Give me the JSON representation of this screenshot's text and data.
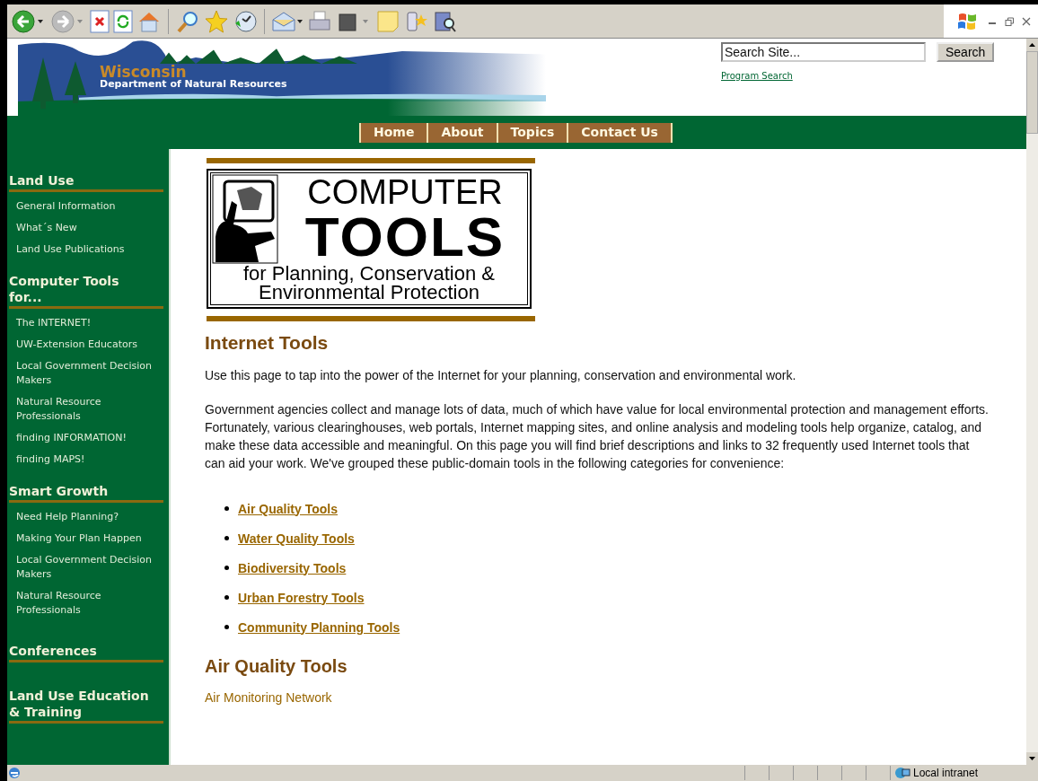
{
  "header": {
    "logo_title": "Wisconsin",
    "logo_subtitle": "Department of Natural Resources",
    "search": {
      "placeholder": "Search Site..."
    },
    "search_button": "Search",
    "program_search_link": "Program Search"
  },
  "nav": [
    {
      "label": "Home"
    },
    {
      "label": "About"
    },
    {
      "label": "Topics"
    },
    {
      "label": "Contact Us"
    }
  ],
  "sidebar": [
    {
      "heading": "Land Use",
      "items": [
        "General Information",
        "What´s New",
        "Land Use Publications"
      ]
    },
    {
      "heading": "Computer Tools for...",
      "items": [
        "The INTERNET!",
        "UW-Extension Educators",
        "Local Government Decision Makers",
        "Natural Resource Professionals",
        "finding INFORMATION!",
        "finding MAPS!"
      ]
    },
    {
      "heading": "Smart Growth",
      "items": [
        "Need Help Planning?",
        "Making Your Plan Happen",
        "Local Government Decision Makers",
        "Natural Resource Professionals"
      ]
    },
    {
      "heading": "Conferences"
    },
    {
      "heading": "Land Use Education & Training"
    }
  ],
  "logo_banner": {
    "line_1": "COMPUTER",
    "line_2": "TOOLS",
    "line_3": "for Planning, Conservation &",
    "line_4": "Environmental Protection"
  },
  "content": {
    "title": "Internet Tools",
    "paragraphs": [
      "Use this page to tap into the power of the Internet for your planning, conservation and environmental work.",
      "Government agencies collect and manage lots of data, much of which have value for local environmental protection and management efforts. Fortunately, various clearinghouses, web portals, Internet mapping sites, and online analysis and modeling tools help organize, catalog, and make these data accessible and meaningful. On this page you will find brief descriptions and links to 32 frequently used Internet tools that can aid your work. We've grouped these public-domain tools in the following categories for convenience:"
    ],
    "category_links": [
      "Air Quality Tools",
      "Water Quality Tools",
      "Biodiversity Tools",
      "Urban Forestry Tools",
      "Community Planning Tools"
    ],
    "section_title": "Air Quality Tools",
    "section_links": [
      "Air Monitoring Network"
    ]
  },
  "status_bar": {
    "zone": "Local intranet"
  }
}
